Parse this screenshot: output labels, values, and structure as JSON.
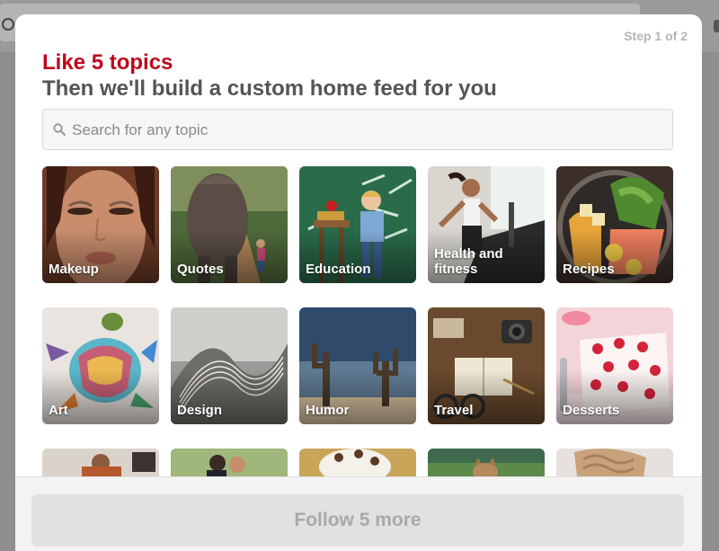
{
  "modal": {
    "step": "Step 1 of 2",
    "title": "Like 5 topics",
    "subtitle": "Then we'll build a custom home feed for you"
  },
  "search": {
    "placeholder": "Search for any topic",
    "icon": "search-icon"
  },
  "topics": [
    {
      "label": "Makeup"
    },
    {
      "label": "Quotes"
    },
    {
      "label": "Education"
    },
    {
      "label": "Health and fitness"
    },
    {
      "label": "Recipes"
    },
    {
      "label": "Art"
    },
    {
      "label": "Design"
    },
    {
      "label": "Humor"
    },
    {
      "label": "Travel"
    },
    {
      "label": "Desserts"
    },
    {
      "label": ""
    },
    {
      "label": ""
    },
    {
      "label": ""
    },
    {
      "label": ""
    },
    {
      "label": ""
    }
  ],
  "footer": {
    "follow_label": "Follow 5 more"
  },
  "colors": {
    "accent": "#bd081c",
    "subtitle": "#555555",
    "button_bg": "#e1e1e1"
  }
}
